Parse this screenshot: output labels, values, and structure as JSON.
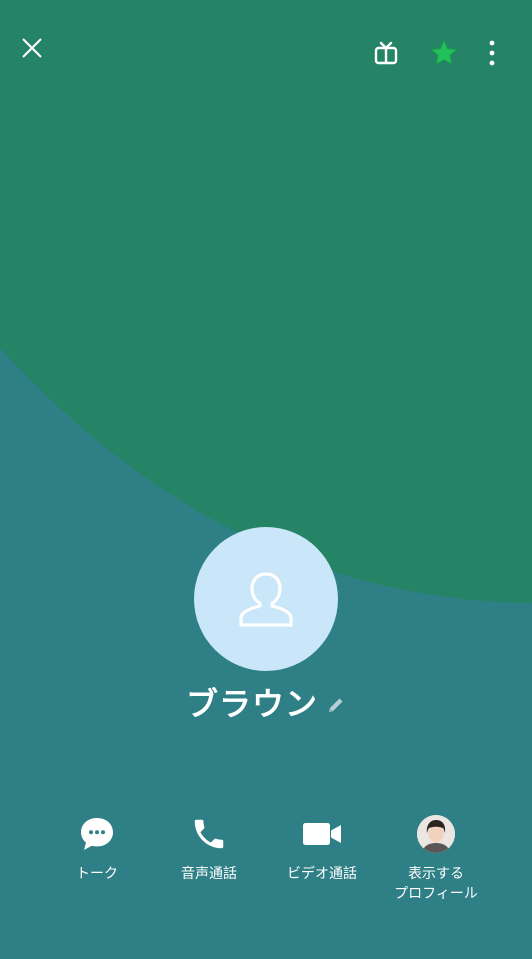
{
  "profile": {
    "name": "ブラウン"
  },
  "actions": [
    {
      "label": "トーク"
    },
    {
      "label": "音声通話"
    },
    {
      "label": "ビデオ通話"
    },
    {
      "label": "表示する\nプロフィール"
    }
  ],
  "icons": {
    "close": "close-icon",
    "gift": "gift-icon",
    "favorite": "star-icon",
    "more": "more-vertical-icon",
    "avatar": "person-icon",
    "edit": "pencil-icon",
    "chat": "chat-bubble-icon",
    "call": "phone-icon",
    "video": "video-camera-icon"
  },
  "colors": {
    "background_top": "#268466",
    "background_bottom": "#2e7f86",
    "favorite_star": "#21c25a",
    "avatar_bg": "#c9e7f8"
  }
}
